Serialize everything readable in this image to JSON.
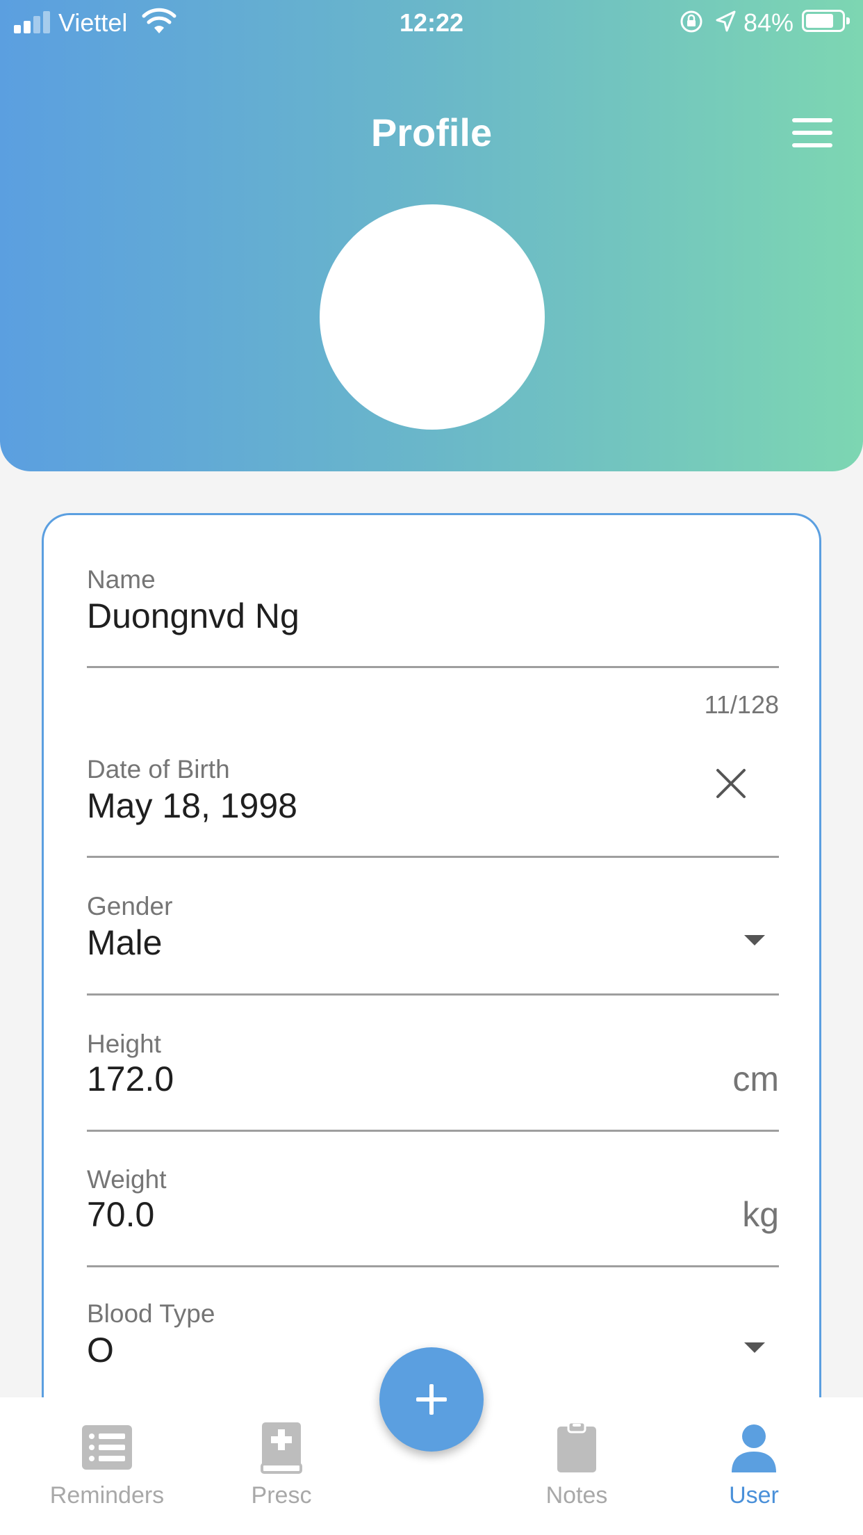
{
  "status_bar": {
    "carrier": "Viettel",
    "time": "12:22",
    "battery_percent": "84%",
    "battery_level": 0.84
  },
  "header": {
    "title": "Profile"
  },
  "form": {
    "name": {
      "label": "Name",
      "value": "Duongnvd Ng",
      "counter": "11/128"
    },
    "dob": {
      "label": "Date of Birth",
      "value": "May 18, 1998"
    },
    "gender": {
      "label": "Gender",
      "value": "Male"
    },
    "height": {
      "label": "Height",
      "value": "172.0",
      "unit": "cm"
    },
    "weight": {
      "label": "Weight",
      "value": "70.0",
      "unit": "kg"
    },
    "blood_type": {
      "label": "Blood Type",
      "value": "O"
    }
  },
  "bottom_nav": {
    "items": [
      {
        "label": "Reminders",
        "icon": "list-icon",
        "active": false
      },
      {
        "label": "Presc",
        "icon": "medical-book-icon",
        "active": false
      },
      {
        "label": "Notes",
        "icon": "clipboard-icon",
        "active": false
      },
      {
        "label": "User",
        "icon": "user-icon",
        "active": true
      }
    ]
  },
  "fab": {
    "icon": "plus-icon"
  },
  "colors": {
    "accent": "#5b9fe0",
    "gradient_start": "#5b9fe0",
    "gradient_end": "#7dd6b2",
    "nav_active": "#4a90d9",
    "nav_inactive": "#a8a8a8"
  }
}
